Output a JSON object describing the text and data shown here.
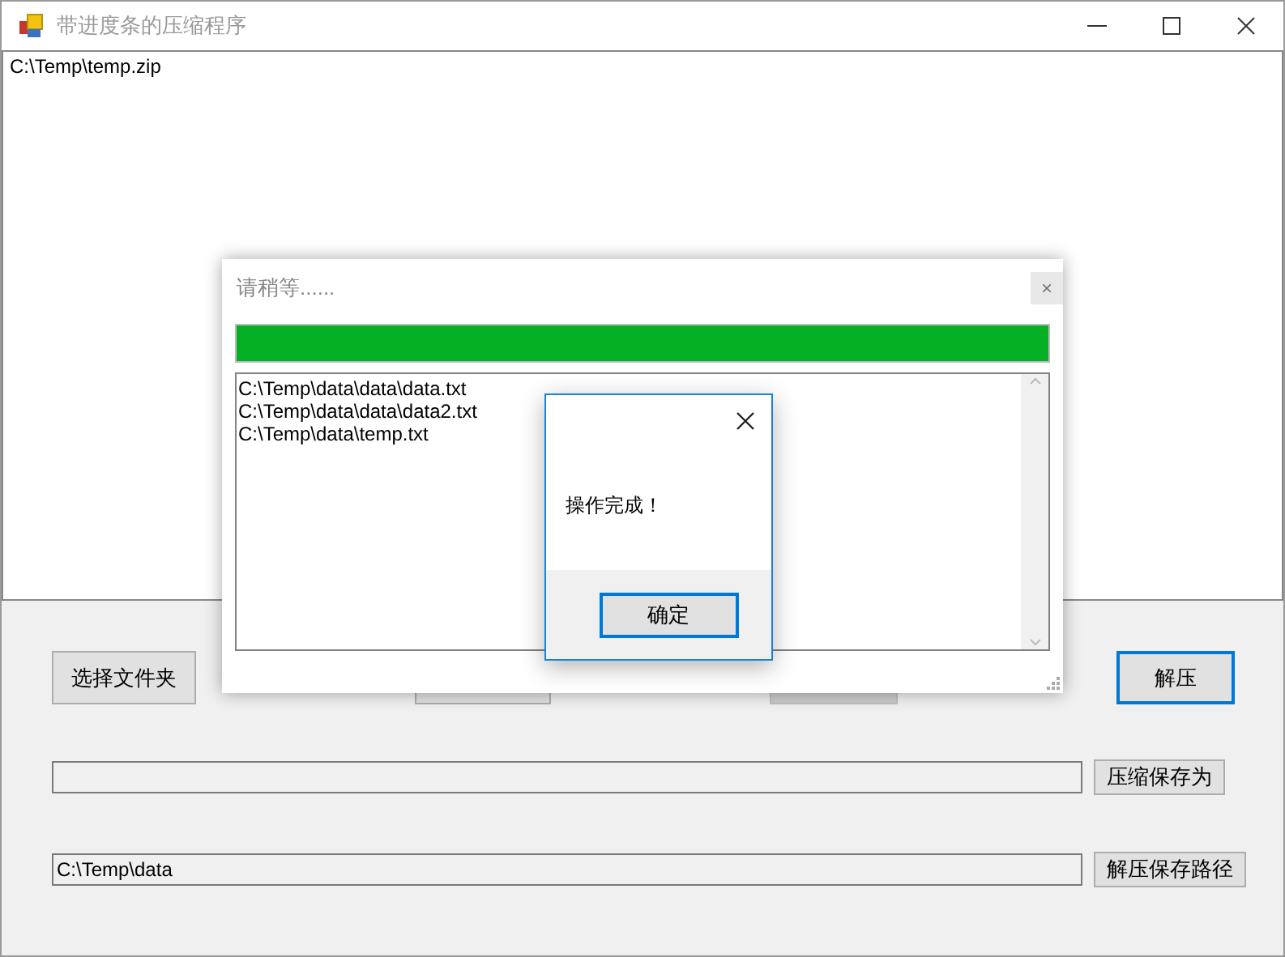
{
  "window": {
    "title": "带进度条的压缩程序"
  },
  "file_list": {
    "items": [
      "C:\\Temp\\temp.zip"
    ]
  },
  "action_buttons": [
    {
      "kind": "text",
      "label": "选择文件夹",
      "focused": false,
      "disabled": false
    },
    {
      "kind": "covered",
      "disabled": false,
      "focused": false
    },
    {
      "kind": "covered",
      "disabled": true,
      "focused": false
    },
    {
      "kind": "text",
      "label": "解压",
      "focused": true,
      "disabled": false
    }
  ],
  "path_rows": [
    {
      "value": "",
      "button": "压缩保存为"
    },
    {
      "value": "C:\\Temp\\data",
      "button": "解压保存路径"
    }
  ],
  "progress_dialog": {
    "title": "请稍等......",
    "close": "×",
    "level": 1,
    "log": [
      "C:\\Temp\\data\\data\\data.txt",
      "C:\\Temp\\data\\data\\data2.txt",
      "C:\\Temp\\data\\temp.txt"
    ]
  },
  "message_box": {
    "message": "操作完成！",
    "button": "确定",
    "button_focused": true
  }
}
